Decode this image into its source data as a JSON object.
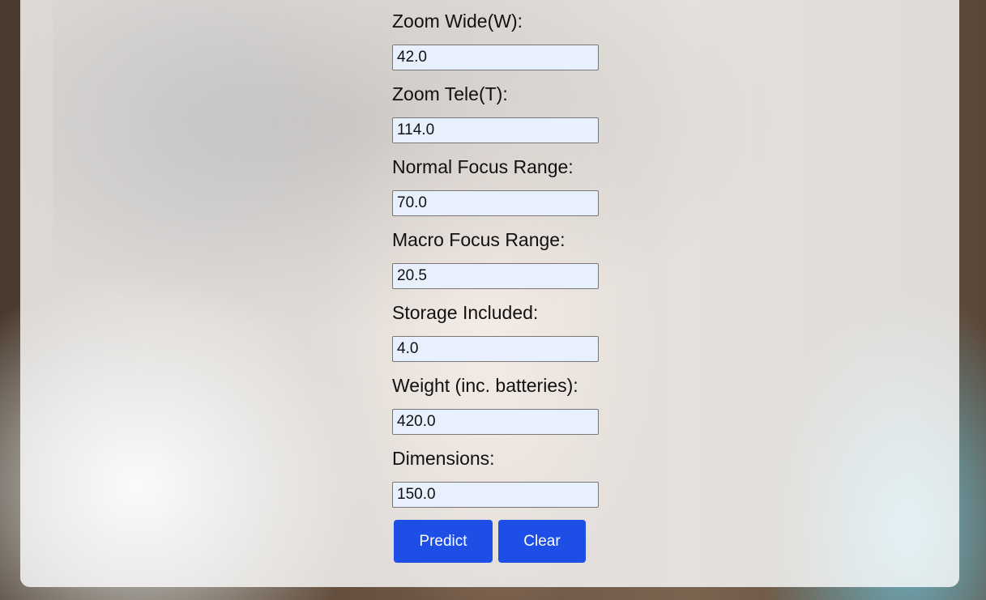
{
  "fields": [
    {
      "label": "Zoom Wide(W):",
      "value": "42.0"
    },
    {
      "label": "Zoom Tele(T):",
      "value": "114.0"
    },
    {
      "label": "Normal Focus Range:",
      "value": "70.0"
    },
    {
      "label": "Macro Focus Range:",
      "value": "20.5"
    },
    {
      "label": "Storage Included:",
      "value": "4.0"
    },
    {
      "label": "Weight (inc. batteries):",
      "value": "420.0"
    },
    {
      "label": "Dimensions:",
      "value": "150.0"
    }
  ],
  "buttons": {
    "predict_label": "Predict",
    "clear_label": "Clear"
  },
  "colors": {
    "button_bg": "#1d4fe6",
    "input_bg": "#e8f0fe"
  }
}
